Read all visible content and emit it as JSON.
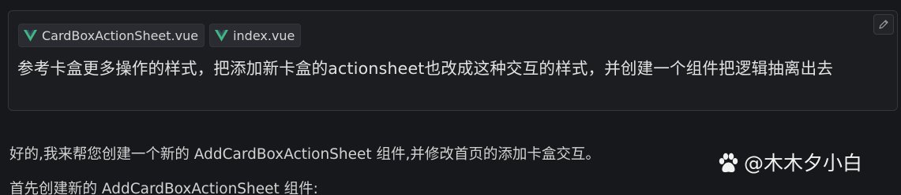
{
  "attachments": [
    {
      "name": "CardBoxActionSheet.vue",
      "icon": "vue-icon"
    },
    {
      "name": "index.vue",
      "icon": "vue-icon"
    }
  ],
  "user_message": "参考卡盒更多操作的样式，把添加新卡盒的actionsheet也改成这种交互的样式，并创建一个组件把逻辑抽离出去",
  "assistant_reply": {
    "line1": "好的,我来帮您创建一个新的 AddCardBoxActionSheet 组件,并修改首页的添加卡盒交互。",
    "line2": "首先创建新的 AddCardBoxActionSheet 组件:"
  },
  "watermark": {
    "text": "@木木夕小白",
    "icon": "baidu-paw-icon"
  },
  "colors": {
    "background": "#17181b",
    "card": "#1c1d21",
    "vue_green": "#41b883"
  }
}
